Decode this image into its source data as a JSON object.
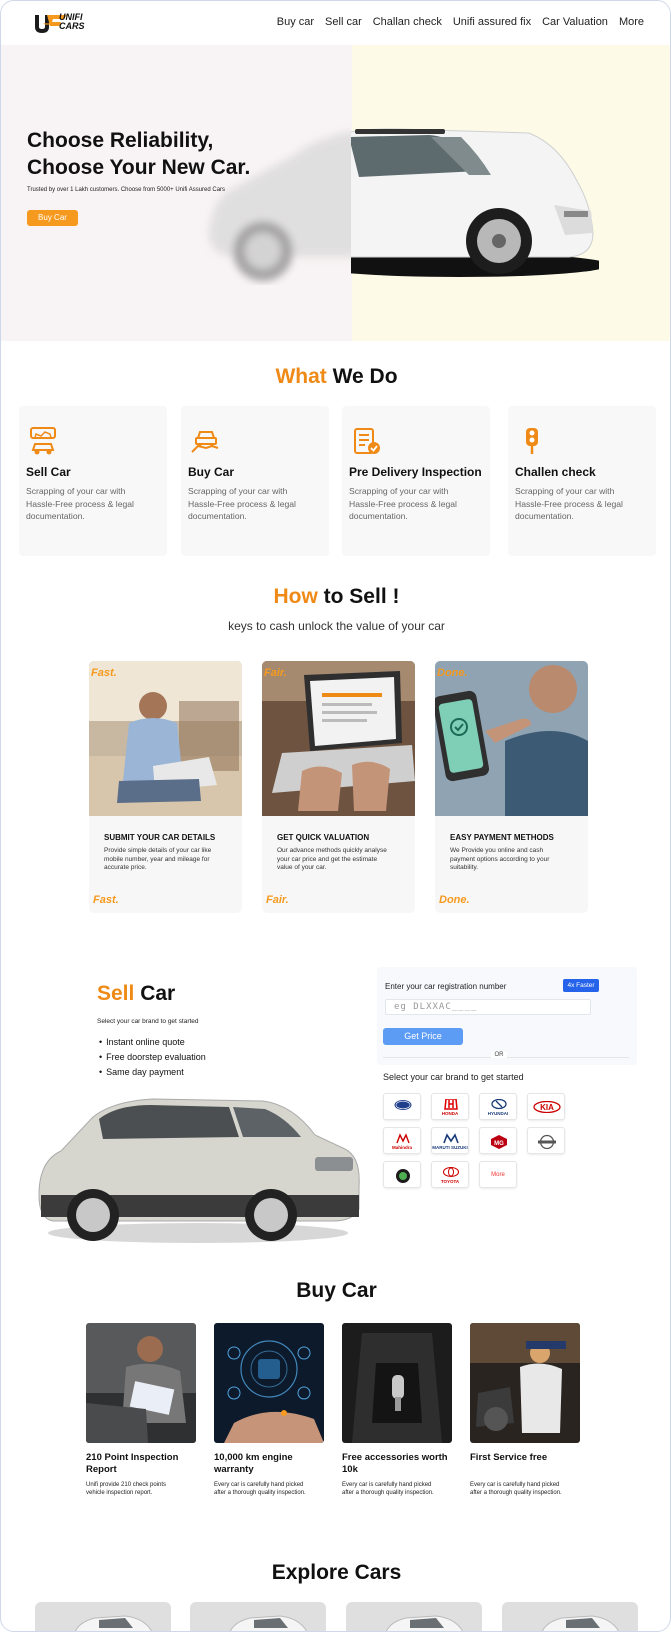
{
  "brand": {
    "logo_mark": "U",
    "logo_text_line1": "UNIFI",
    "logo_text_line2": "CARS"
  },
  "nav": {
    "items": [
      "Buy car",
      "Sell car",
      "Challan check",
      "Unifi assured fix",
      "Car Valuation",
      "More"
    ]
  },
  "hero": {
    "title_line1": "Choose Reliability,",
    "title_line2": "Choose Your New Car.",
    "subtitle": "Trusted by over 1 Lakh customers.    Choose from 5000+ Unifi Assured Cars",
    "button": "Buy Car",
    "left_bg": "#f8f3f4",
    "right_bg": "#fdfbe8"
  },
  "what_we_do": {
    "title_accent": "What",
    "title_rest": " We Do",
    "cards": [
      {
        "icon": "sell-car-icon",
        "title": "Sell Car",
        "desc": "Scrapping of your car with Hassle-Free process & legal documentation."
      },
      {
        "icon": "buy-car-icon",
        "title": "Buy Car",
        "desc": "Scrapping of your car with Hassle-Free process & legal documentation."
      },
      {
        "icon": "inspection-icon",
        "title": "Pre Delivery Inspection",
        "desc": "Scrapping of your car with Hassle-Free process & legal documentation."
      },
      {
        "icon": "traffic-light-icon",
        "title": "Challen check",
        "desc": "Scrapping of your car with Hassle-Free process & legal documentation."
      }
    ]
  },
  "how_to_sell": {
    "title_accent": "How",
    "title_rest": " to Sell !",
    "subtitle": "keys to cash unlock the value of your car",
    "cards": [
      {
        "badge": "Fast.",
        "title": "SUBMIT YOUR CAR DETAILS",
        "desc": "Provide simple details of your car like mobile number, year and mileage for accurate price."
      },
      {
        "badge": "Fair.",
        "title": "GET QUICK VALUATION",
        "desc": "Our advance methods quickly analyse your car price and get the estimate value of your car."
      },
      {
        "badge": "Done.",
        "title": "EASY PAYMENT METHODS",
        "desc": "We Provide you online and cash payment options according to your suitability."
      }
    ]
  },
  "sell_car": {
    "title_accent": "Sell",
    "title_rest": " Car",
    "subtitle": "Select your car brand to get started",
    "bullets": [
      "Instant online quote",
      "Free doorstep evaluation",
      "Same day payment"
    ],
    "reg_label": "Enter your car registration number",
    "reg_badge": "4x Faster",
    "reg_placeholder": "eg DLXXAC____",
    "get_price": "Get Price",
    "or": "OR",
    "brand_label": "Select your car brand to get started",
    "brands": [
      "Ford",
      "HONDA",
      "HYUNDAI",
      "KIA",
      "Mahindra",
      "MARUTI SUZUKI",
      "MG",
      "Nissan",
      "SKODA",
      "TOYOTA",
      "More"
    ]
  },
  "buy_car": {
    "title": "Buy Car",
    "cards": [
      {
        "title": "210 Point Inspection Report",
        "desc": "Unifi provide 210 check points vehicle inspection report."
      },
      {
        "title": "10,000 km engine warranty",
        "desc": "Every car is carefully hand picked after a thorough quality inspection."
      },
      {
        "title": "Free accessories worth 10k",
        "desc": "Every car is carefully hand picked after a thorough quality inspection."
      },
      {
        "title": "First Service free",
        "desc": "Every car is carefully hand picked after a thorough quality inspection."
      }
    ]
  },
  "explore": {
    "title": "Explore Cars"
  },
  "colors": {
    "accent": "#ef8a17",
    "button_orange": "#f59a1e",
    "primary_blue": "#5c9cf5"
  }
}
